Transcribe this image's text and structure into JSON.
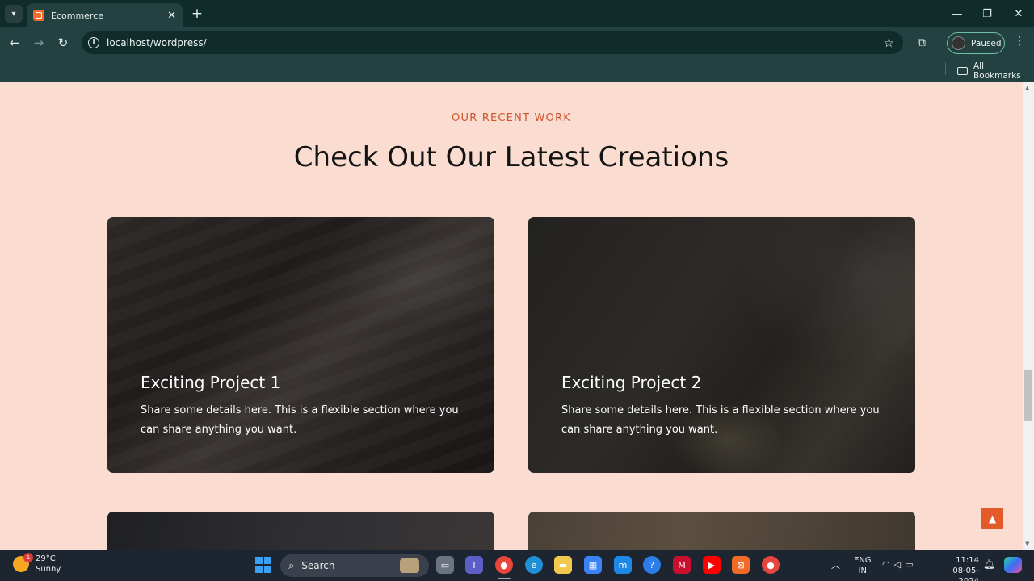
{
  "browser": {
    "tab_title": "Ecommerce",
    "url": "localhost/wordpress/",
    "profile_status": "Paused",
    "bookmarks_label": "All Bookmarks"
  },
  "page": {
    "eyebrow": "OUR RECENT WORK",
    "headline": "Check Out Our Latest Creations",
    "cards": [
      {
        "title": "Exciting Project 1",
        "description": "Share some details here. This is a flexible section where you can share anything you want."
      },
      {
        "title": "Exciting Project 2",
        "description": "Share some details here. This is a flexible section where you can share anything you want."
      }
    ],
    "accent_color": "#e35a2b",
    "background_color": "#fadcd0"
  },
  "taskbar": {
    "weather_temp": "29°C",
    "weather_desc": "Sunny",
    "weather_badge": "1",
    "search_label": "Search",
    "lang_top": "ENG",
    "lang_bottom": "IN",
    "time": "11:14",
    "date": "08-05-2024"
  }
}
